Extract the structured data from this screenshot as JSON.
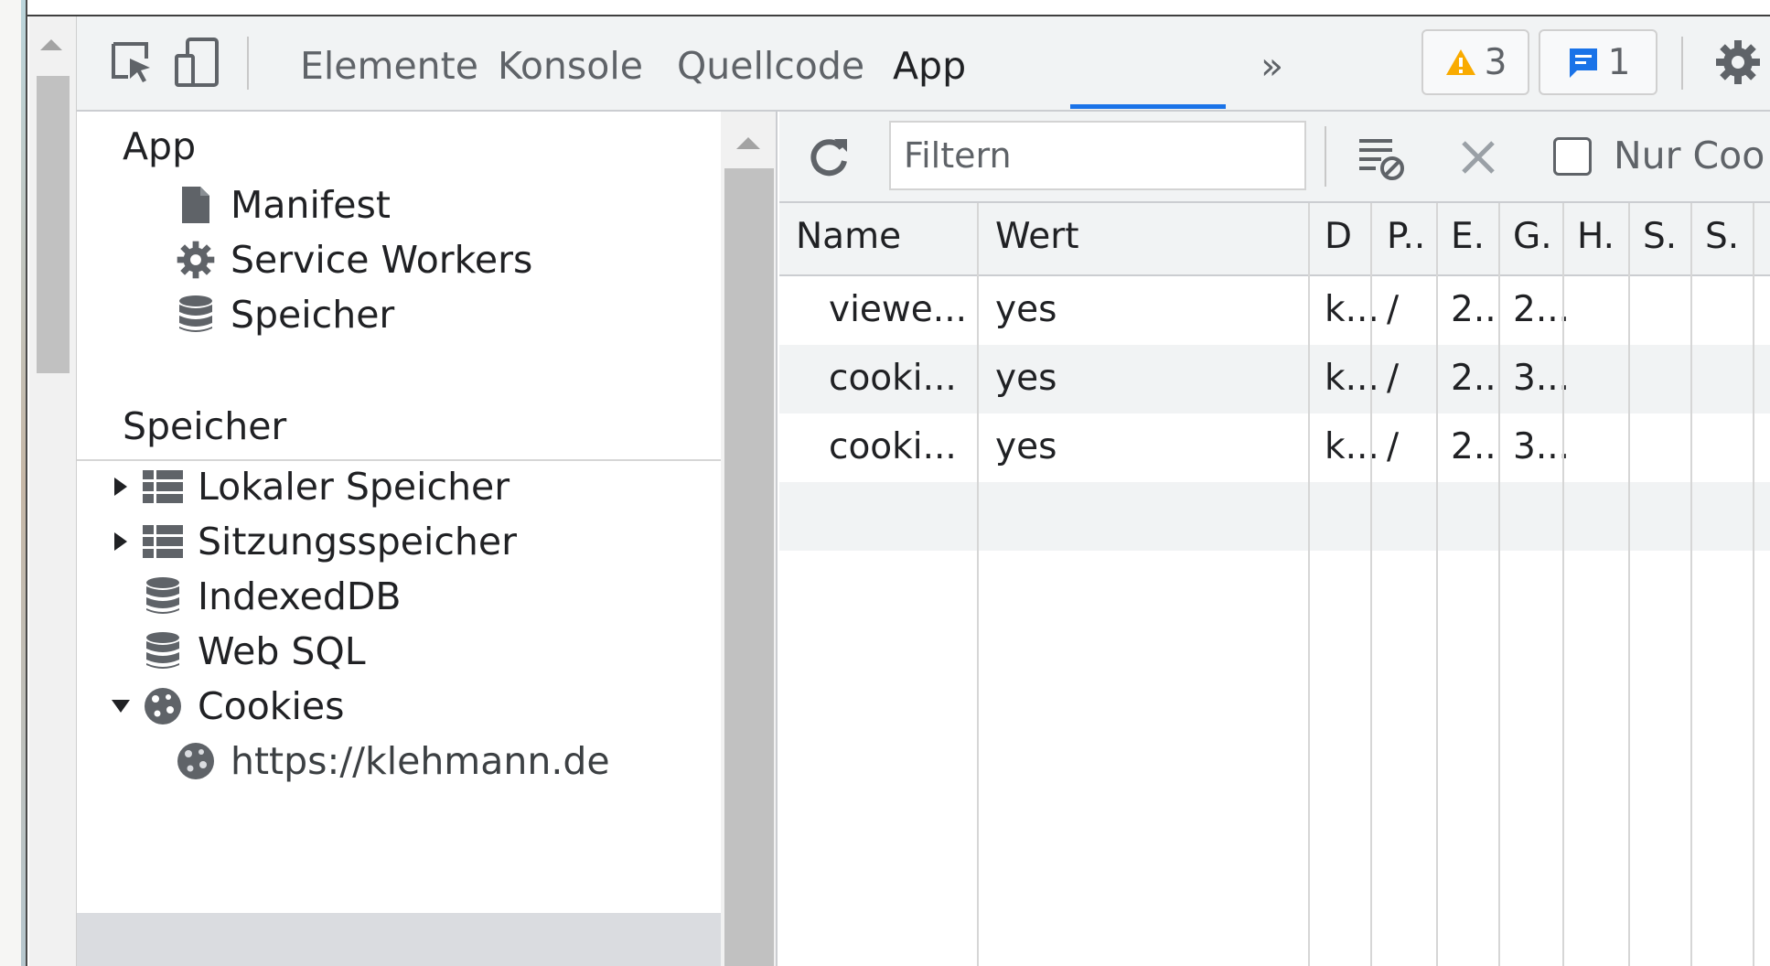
{
  "toolbar": {
    "tabs": [
      {
        "label": "Elemente"
      },
      {
        "label": "Konsole"
      },
      {
        "label": "Quellcode"
      },
      {
        "label": "App"
      }
    ],
    "overflow": "»",
    "warnings_count": "3",
    "messages_count": "1",
    "icons": [
      "inspect-element-icon",
      "device-toolbar-icon",
      "chevron-double-right-icon",
      "warning-icon",
      "message-icon",
      "gear-icon"
    ]
  },
  "sidebar": {
    "app_section": {
      "title": "App",
      "items": [
        {
          "label": "Manifest",
          "icon": "file-icon"
        },
        {
          "label": "Service Workers",
          "icon": "gear-icon"
        },
        {
          "label": "Speicher",
          "icon": "database-icon"
        }
      ]
    },
    "storage_section": {
      "title": "Speicher",
      "items": [
        {
          "label": "Lokaler Speicher",
          "icon": "table-icon",
          "expandable": true,
          "expanded": false
        },
        {
          "label": "Sitzungsspeicher",
          "icon": "table-icon",
          "expandable": true,
          "expanded": false
        },
        {
          "label": "IndexedDB",
          "icon": "database-icon"
        },
        {
          "label": "Web SQL",
          "icon": "database-icon"
        },
        {
          "label": "Cookies",
          "icon": "cookie-icon",
          "expandable": true,
          "expanded": true
        },
        {
          "label": "https://klehmann.de",
          "icon": "cookie-icon",
          "selected": true
        }
      ]
    }
  },
  "filter_bar": {
    "placeholder": "Filtern",
    "only_cookies_label": "Nur Coo",
    "icons": [
      "refresh-icon",
      "clear-filtered-icon",
      "delete-icon",
      "checkbox"
    ]
  },
  "cookie_table": {
    "columns": [
      "Name",
      "Wert",
      "D",
      "P..",
      "E.",
      "G.",
      "H.",
      "S.",
      "S."
    ],
    "rows": [
      [
        "viewe...",
        "yes",
        "k...",
        "/",
        "2..",
        "2...",
        "",
        "",
        ""
      ],
      [
        "cooki...",
        "yes",
        "k...",
        "/",
        "2..",
        "3...",
        "",
        "",
        ""
      ],
      [
        "cooki...",
        "yes",
        "k...",
        "/",
        "2..",
        "3...",
        "",
        "",
        ""
      ]
    ]
  },
  "colors": {
    "accent": "#1a73e8",
    "warning": "#f9ab00",
    "toolbar_bg": "#f1f3f4",
    "selected_bg": "#dadce0",
    "text": "#202124"
  }
}
